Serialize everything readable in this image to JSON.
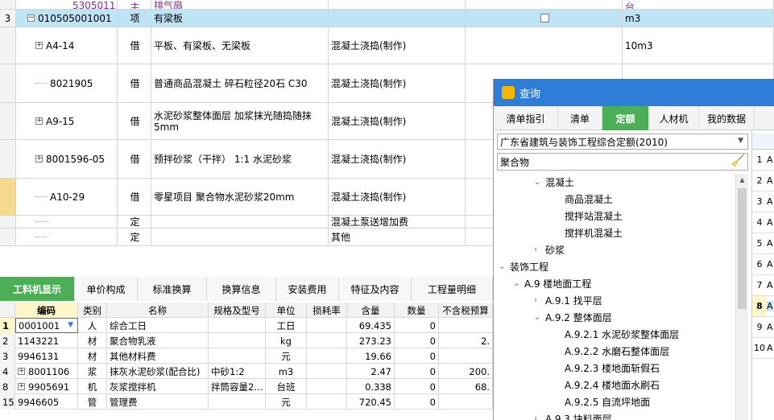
{
  "top_rows": [
    {
      "num": "",
      "code": "5305011",
      "type": "主",
      "name": "排气扇",
      "work": "",
      "unit": "台",
      "purple": true,
      "cut": true
    },
    {
      "num": "3",
      "code": "010505001001",
      "type": "项",
      "name": "有梁板",
      "work": "",
      "unit": "m3",
      "selected": true,
      "expander": "−",
      "checkbox": true
    },
    {
      "num": "",
      "code": "A4-14",
      "type": "借",
      "name": "平板、有梁板、无梁板",
      "work": "混凝土浇捣(制作)",
      "unit": "10m3",
      "expander": "+"
    },
    {
      "num": "",
      "code": "8021905",
      "type": "借",
      "name": "普通商品混凝土 碎石粒径20石 C30",
      "work": "混凝土浇捣(制作)",
      "unit": "",
      "line": true
    },
    {
      "num": "",
      "code": "A9-15",
      "type": "借",
      "name": "水泥砂浆整体面层 加浆抹光随捣随抹5mm",
      "work": "混凝土浇捣(制作)",
      "unit": "",
      "expander": "+"
    },
    {
      "num": "",
      "code": "8001596-05",
      "type": "借",
      "name": "预拌砂浆（干拌） 1:1 水泥砂浆",
      "work": "混凝土浇捣(制作)",
      "unit": "",
      "expander": "+"
    },
    {
      "num": "",
      "code": "A10-29",
      "type": "借",
      "name": "零星项目 聚合物水泥砂浆20mm",
      "work": "混凝土浇捣(制作)",
      "unit": "",
      "line": true,
      "marker": true
    },
    {
      "num": "",
      "code": "",
      "type": "定",
      "name": "",
      "work": "混凝土泵送增加费",
      "unit": "",
      "line": true
    },
    {
      "num": "",
      "code": "",
      "type": "定",
      "name": "",
      "work": "其他",
      "unit": "",
      "line": true
    }
  ],
  "bottom_tabs": [
    "工料机显示",
    "单价构成",
    "标准换算",
    "换算信息",
    "安装费用",
    "特征及内容",
    "工程量明细"
  ],
  "bottom_headers": [
    "",
    "编码",
    "类别",
    "名称",
    "规格及型号",
    "单位",
    "损耗率",
    "含量",
    "数量",
    "不含税预算"
  ],
  "bottom_rows": [
    {
      "n": "1",
      "code": "0001001",
      "type": "人",
      "name": "综合工日",
      "spec": "",
      "unit": "工日",
      "loss": "",
      "qty": "69.435",
      "amount": "0",
      "price": "",
      "dropdown": true
    },
    {
      "n": "2",
      "code": "1143221",
      "type": "材",
      "name": "聚合物乳液",
      "spec": "",
      "unit": "kg",
      "loss": "",
      "qty": "273.23",
      "amount": "0",
      "price": "2."
    },
    {
      "n": "3",
      "code": "9946131",
      "type": "材",
      "name": "其他材料费",
      "spec": "",
      "unit": "元",
      "loss": "",
      "qty": "19.66",
      "amount": "0",
      "price": ""
    },
    {
      "n": "4",
      "code": "8001106",
      "type": "浆",
      "name": "抹灰水泥砂浆(配合比)",
      "spec": "中砂1:2",
      "unit": "m3",
      "loss": "",
      "qty": "2.47",
      "amount": "0",
      "price": "200.",
      "exp": true
    },
    {
      "n": "8",
      "code": "9905691",
      "type": "机",
      "name": "灰浆搅拌机",
      "spec": "拌筒容量2…",
      "unit": "台班",
      "loss": "",
      "qty": "0.338",
      "amount": "0",
      "price": "68.",
      "exp": true
    },
    {
      "n": "15",
      "code": "9946605",
      "type": "管",
      "name": "管理费",
      "spec": "",
      "unit": "元",
      "loss": "",
      "qty": "720.45",
      "amount": "0",
      "price": ""
    }
  ],
  "dialog": {
    "title": "查询",
    "tabs": [
      "清单指引",
      "清单",
      "定额",
      "人材机",
      "我的数据"
    ],
    "active_tab": 2,
    "quota_select": "广东省建筑与装饰工程综合定额(2010)",
    "search_value": "聚合物",
    "tree": [
      {
        "label": "混凝土",
        "level": 2,
        "arrow": "down"
      },
      {
        "label": "商品混凝土",
        "level": 4,
        "arrow": ""
      },
      {
        "label": "搅拌站混凝土",
        "level": 4,
        "arrow": ""
      },
      {
        "label": "搅拌机混凝土",
        "level": 4,
        "arrow": ""
      },
      {
        "label": "砂浆",
        "level": 2,
        "arrow": "right"
      },
      {
        "label": "装饰工程",
        "level": 0,
        "arrow": "down"
      },
      {
        "label": "A.9 楼地面工程",
        "level": 1,
        "arrow": "down"
      },
      {
        "label": "A.9.1 找平层",
        "level": 2,
        "arrow": "right"
      },
      {
        "label": "A.9.2 整体面层",
        "level": 2,
        "arrow": "down"
      },
      {
        "label": "A.9.2.1 水泥砂浆整体面层",
        "level": 4,
        "arrow": ""
      },
      {
        "label": "A.9.2.2 水磨石整体面层",
        "level": 4,
        "arrow": ""
      },
      {
        "label": "A.9.2.3 楼地面斩假石",
        "level": 4,
        "arrow": ""
      },
      {
        "label": "A.9.2.4 楼地面水刷石",
        "level": 4,
        "arrow": ""
      },
      {
        "label": "A.9.2.5 自流坪地面",
        "level": 4,
        "arrow": ""
      },
      {
        "label": "A.9.3 块料面层",
        "level": 2,
        "arrow": "right"
      }
    ],
    "right_rows": [
      "1",
      "2",
      "3",
      "4",
      "5",
      "6",
      "7",
      "8",
      "9",
      "10"
    ],
    "right_letter": "A",
    "selected_right_row": 7
  },
  "colors": {
    "tab_green": "#4cae56",
    "title_blue": "#2f7dd6",
    "select_row": "#bfe4f6",
    "purple": "#7b2d8b"
  }
}
